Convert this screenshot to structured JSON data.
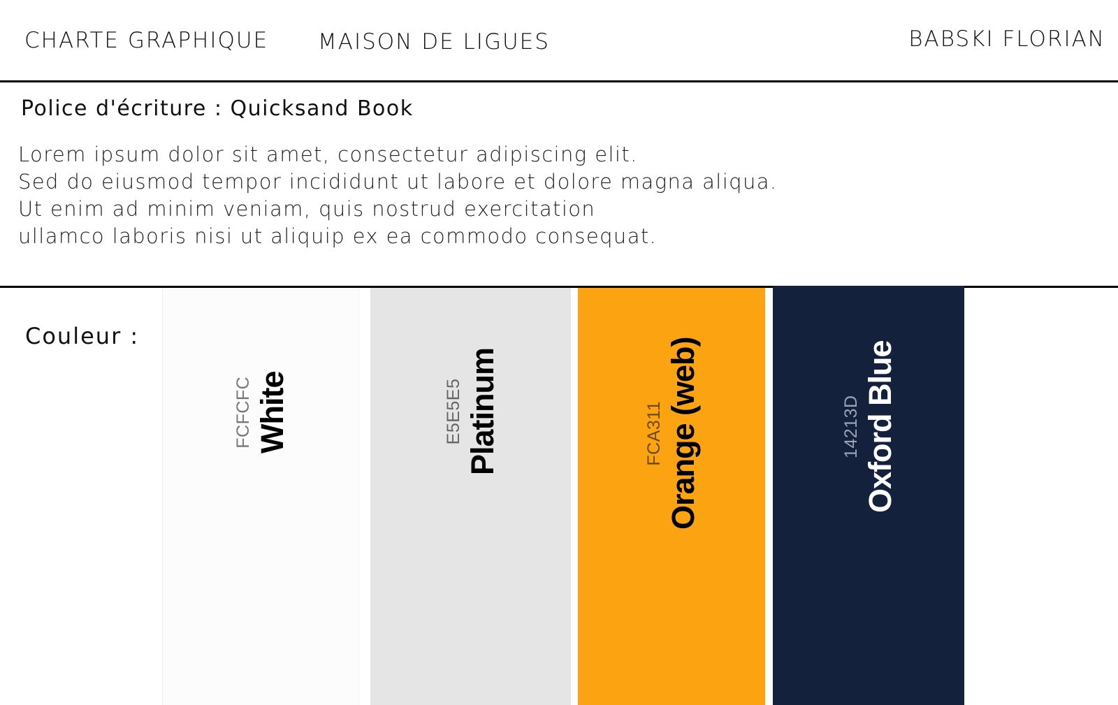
{
  "header": {
    "left": "CHARTE GRAPHIQUE",
    "middle": "MAISON DE LIGUES",
    "right": "BABSKI FLORIAN"
  },
  "font_section": {
    "heading": "Police d'écriture : Quicksand Book",
    "lorem_lines": [
      "Lorem ipsum dolor sit amet, consectetur adipiscing elit.",
      "Sed do eiusmod tempor incididunt ut labore et dolore magna aliqua.",
      "Ut enim ad minim veniam, quis nostrud exercitation",
      "ullamco laboris nisi ut aliquip ex ea commodo consequat."
    ]
  },
  "color_section": {
    "label": "Couleur :",
    "swatches": [
      {
        "hex": "FCFCFC",
        "name": "White",
        "color": "#FCFCFC",
        "text_color": "#000000",
        "hex_color": "#777777"
      },
      {
        "hex": "E5E5E5",
        "name": "Platinum",
        "color": "#E5E5E5",
        "text_color": "#000000",
        "hex_color": "#666666"
      },
      {
        "hex": "FCA311",
        "name": "Orange (web)",
        "color": "#FCA311",
        "text_color": "#000000",
        "hex_color": "#6b4a10"
      },
      {
        "hex": "14213D",
        "name": "Oxford Blue",
        "color": "#14213D",
        "text_color": "#FFFFFF",
        "hex_color": "#9aa3b5"
      }
    ]
  }
}
